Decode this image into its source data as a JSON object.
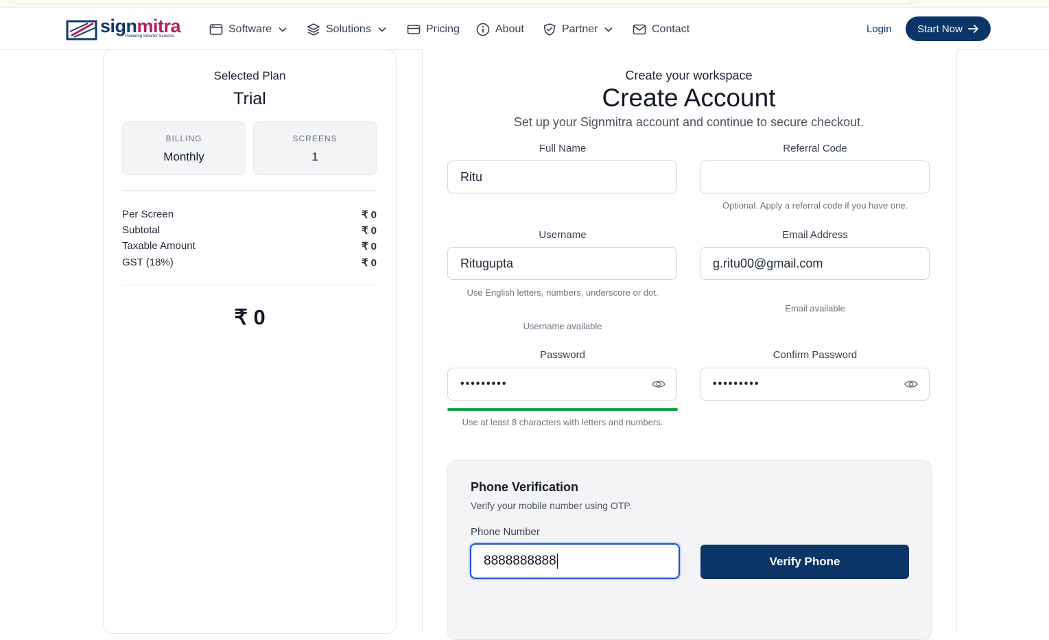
{
  "brand": {
    "name_part1": "sign",
    "name_part2": "mitra",
    "tagline": "Powering Smarter Screens"
  },
  "nav": {
    "items": [
      {
        "label": "Software",
        "icon": "window-icon",
        "dropdown": true
      },
      {
        "label": "Solutions",
        "icon": "layers-icon",
        "dropdown": true
      },
      {
        "label": "Pricing",
        "icon": "card-icon",
        "dropdown": false
      },
      {
        "label": "About",
        "icon": "info-icon",
        "dropdown": false
      },
      {
        "label": "Partner",
        "icon": "handshake-shield-icon",
        "dropdown": true
      },
      {
        "label": "Contact",
        "icon": "mail-icon",
        "dropdown": false
      }
    ],
    "login": "Login",
    "start": "Start Now"
  },
  "summary": {
    "selected_label": "Selected Plan",
    "plan": "Trial",
    "billing_key": "BILLING",
    "billing_value": "Monthly",
    "screens_key": "SCREENS",
    "screens_value": "1",
    "rows": [
      {
        "label": "Per Screen",
        "amount": "₹ 0"
      },
      {
        "label": "Subtotal",
        "amount": "₹ 0"
      },
      {
        "label": "Taxable Amount",
        "amount": "₹ 0"
      },
      {
        "label": "GST (18%)",
        "amount": "₹ 0"
      }
    ],
    "total": "₹ 0"
  },
  "form": {
    "eyebrow": "Create your workspace",
    "title": "Create Account",
    "subtitle": "Set up your Signmitra account and continue to secure checkout.",
    "full_name_label": "Full Name",
    "full_name_value": "Ritu",
    "referral_label": "Referral Code",
    "referral_value": "",
    "referral_hint": "Optional. Apply a referral code if you have one.",
    "username_label": "Username",
    "username_value": "Ritugupta",
    "username_hint": "Use English letters, numbers, underscore or dot.",
    "username_status": "Username available",
    "email_label": "Email Address",
    "email_value": "g.ritu00@gmail.com",
    "email_status": "Email available",
    "password_label": "Password",
    "password_mask": "•••••••••",
    "password_strength": 1.0,
    "password_hint": "Use at least 8 characters with letters and numbers.",
    "confirm_label": "Confirm Password",
    "confirm_mask": "•••••••••"
  },
  "phone": {
    "title": "Phone Verification",
    "subtitle": "Verify your mobile number using OTP.",
    "label": "Phone Number",
    "value": "8888888888",
    "button": "Verify Phone"
  },
  "colors": {
    "primary": "#0b3566",
    "brand_blue": "#123a6b",
    "brand_magenta": "#b21f5e",
    "success": "#16a34a"
  }
}
